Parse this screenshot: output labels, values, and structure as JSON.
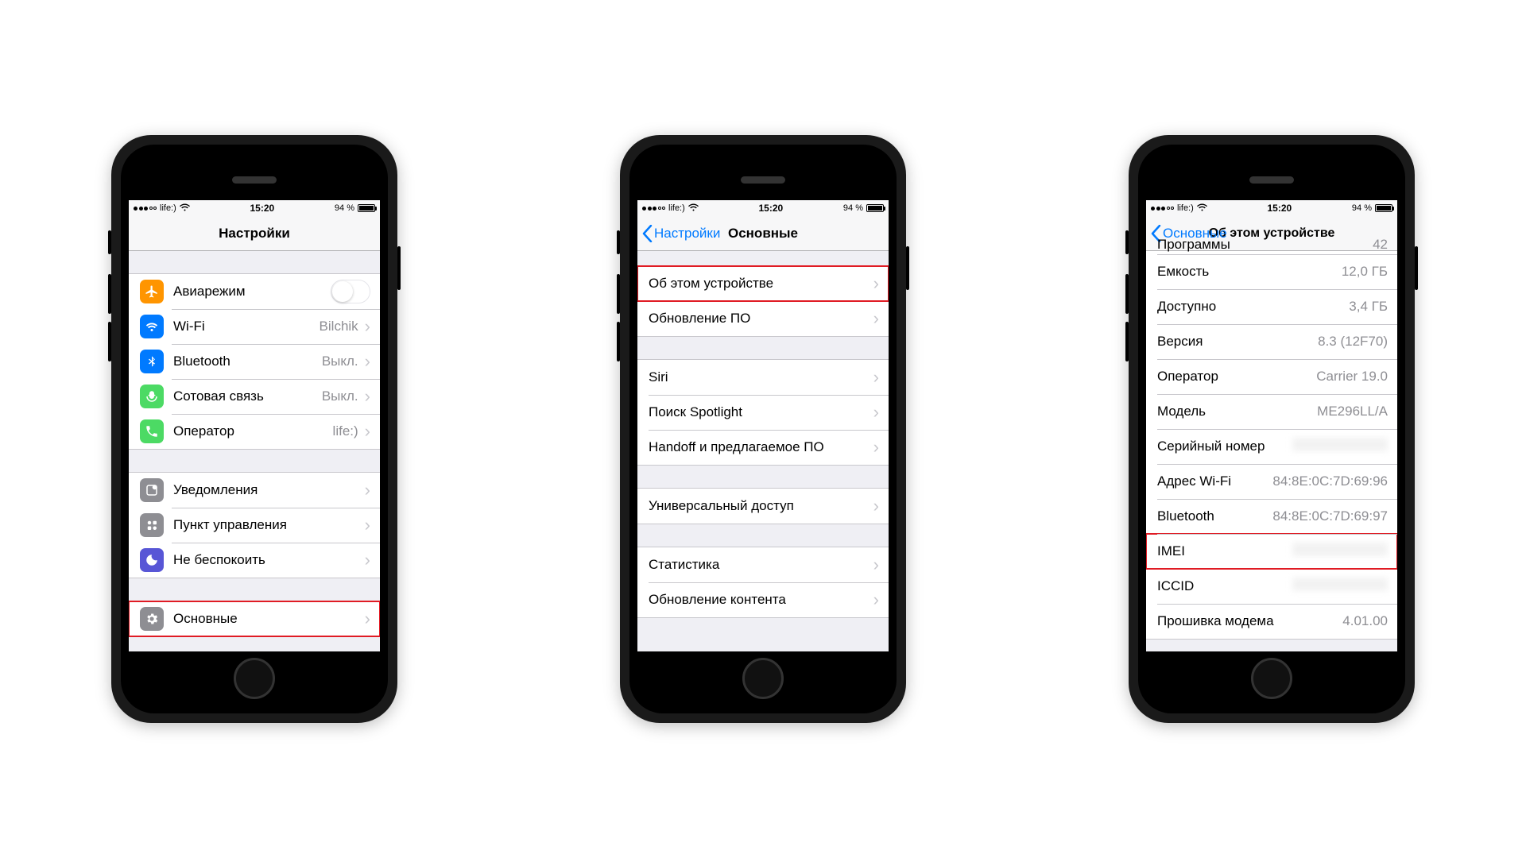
{
  "status": {
    "carrier": "life:)",
    "time": "15:20",
    "battery": "94 %"
  },
  "wifi_glyph": "⌇",
  "screen1": {
    "title": "Настройки",
    "rows1": [
      {
        "icon": "airplane",
        "label": "Авиарежим",
        "type": "switch"
      },
      {
        "icon": "wifi",
        "label": "Wi-Fi",
        "value": "Bilchik",
        "chev": true
      },
      {
        "icon": "bt",
        "label": "Bluetooth",
        "value": "Выкл.",
        "chev": true
      },
      {
        "icon": "cell",
        "label": "Сотовая связь",
        "value": "Выкл.",
        "chev": true
      },
      {
        "icon": "carrier",
        "label": "Оператор",
        "value": "life:)",
        "chev": true
      }
    ],
    "rows2": [
      {
        "icon": "notif",
        "label": "Уведомления",
        "chev": true
      },
      {
        "icon": "cc",
        "label": "Пункт управления",
        "chev": true
      },
      {
        "icon": "dnd",
        "label": "Не беспокоить",
        "chev": true
      }
    ],
    "rows3": [
      {
        "icon": "general",
        "label": "Основные",
        "chev": true,
        "highlight": true
      }
    ]
  },
  "screen2": {
    "back": "Настройки",
    "title": "Основные",
    "g1": [
      {
        "label": "Об этом устройстве",
        "chev": true,
        "highlight": true
      },
      {
        "label": "Обновление ПО",
        "chev": true
      }
    ],
    "g2": [
      {
        "label": "Siri",
        "chev": true
      },
      {
        "label": "Поиск Spotlight",
        "chev": true
      },
      {
        "label": "Handoff и предлагаемое ПО",
        "chev": true
      }
    ],
    "g3": [
      {
        "label": "Универсальный доступ",
        "chev": true
      }
    ],
    "g4": [
      {
        "label": "Статистика",
        "chev": true
      },
      {
        "label": "Обновление контента",
        "chev": true
      }
    ]
  },
  "screen3": {
    "back": "Основные",
    "title": "Об этом устройстве",
    "rows": [
      {
        "label": "Программы",
        "value": "42",
        "cut": true
      },
      {
        "label": "Емкость",
        "value": "12,0 ГБ"
      },
      {
        "label": "Доступно",
        "value": "3,4 ГБ"
      },
      {
        "label": "Версия",
        "value": "8.3 (12F70)"
      },
      {
        "label": "Оператор",
        "value": "Carrier 19.0"
      },
      {
        "label": "Модель",
        "value": "ME296LL/A"
      },
      {
        "label": "Серийный номер",
        "value": "",
        "blur": true
      },
      {
        "label": "Адрес Wi-Fi",
        "value": "84:8E:0C:7D:69:96"
      },
      {
        "label": "Bluetooth",
        "value": "84:8E:0C:7D:69:97"
      },
      {
        "label": "IMEI",
        "value": "",
        "blur": true,
        "highlight": true
      },
      {
        "label": "ICCID",
        "value": "",
        "blur": true
      },
      {
        "label": "Прошивка модема",
        "value": "4.01.00"
      }
    ]
  }
}
